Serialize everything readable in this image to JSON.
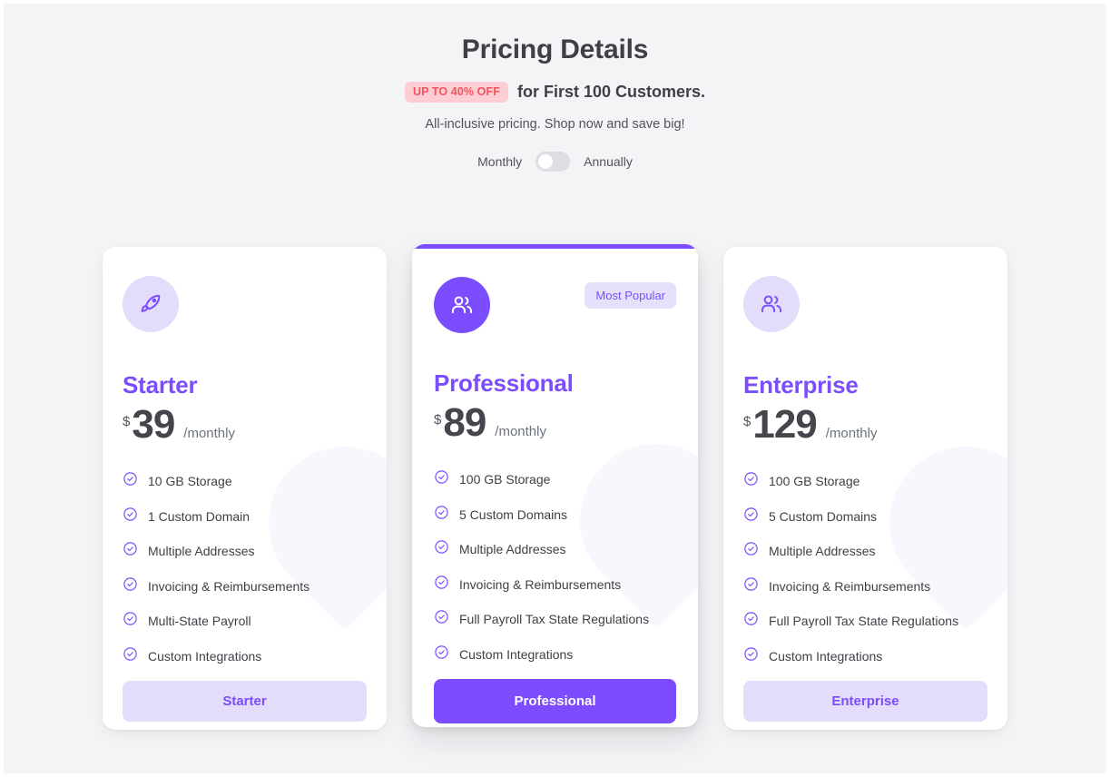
{
  "header": {
    "title": "Pricing Details",
    "discount_badge": "UP TO 40% OFF",
    "subline": "for First 100 Customers.",
    "tagline": "All-inclusive pricing. Shop now and save big!",
    "toggle": {
      "left_label": "Monthly",
      "right_label": "Annually",
      "selected": "Monthly"
    }
  },
  "colors": {
    "accent": "#7c4dff",
    "accent_soft": "#e4dcfb",
    "page_bg": "#f3f4f6",
    "card_bg": "#ffffff",
    "discount_bg": "#fecdd3",
    "discount_text": "#f4525f",
    "price_text": "#45454d",
    "body_text": "#3f3f46"
  },
  "plans": [
    {
      "id": "starter",
      "icon": "rocket-icon",
      "name": "Starter",
      "currency": "$",
      "amount": "39",
      "period": "/monthly",
      "featured": false,
      "badge": null,
      "features": [
        "10 GB Storage",
        "1 Custom Domain",
        "Multiple Addresses",
        "Invoicing & Reimbursements",
        "Multi-State Payroll",
        "Custom Integrations"
      ],
      "cta_label": "Starter"
    },
    {
      "id": "professional",
      "icon": "users-icon",
      "name": "Professional",
      "currency": "$",
      "amount": "89",
      "period": "/monthly",
      "featured": true,
      "badge": "Most Popular",
      "features": [
        "100 GB Storage",
        "5 Custom Domains",
        "Multiple Addresses",
        "Invoicing & Reimbursements",
        "Full Payroll Tax State Regulations",
        "Custom Integrations"
      ],
      "cta_label": "Professional"
    },
    {
      "id": "enterprise",
      "icon": "users-icon",
      "name": "Enterprise",
      "currency": "$",
      "amount": "129",
      "period": "/monthly",
      "featured": false,
      "badge": null,
      "features": [
        "100 GB Storage",
        "5 Custom Domains",
        "Multiple Addresses",
        "Invoicing & Reimbursements",
        "Full Payroll Tax State Regulations",
        "Custom Integrations"
      ],
      "cta_label": "Enterprise"
    }
  ]
}
